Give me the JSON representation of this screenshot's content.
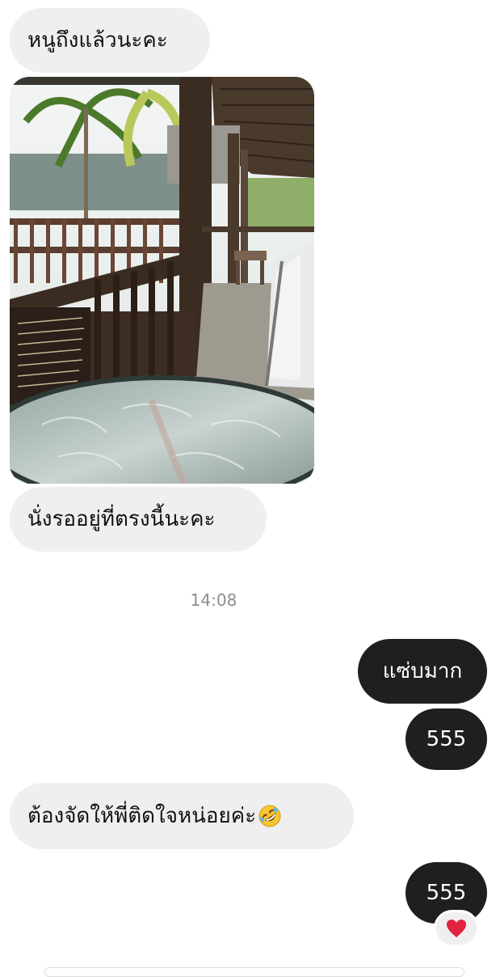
{
  "messages": [
    {
      "text": "หนูถึงแล้วนะคะ"
    },
    {
      "image": "veranda-photo"
    },
    {
      "text": "นั่งรออยู่ที่ตรงนี้นะคะ"
    },
    {
      "text": "แซ่บมาก"
    },
    {
      "text": "555"
    },
    {
      "text": "ต้องจัดให้พี่ติดใจหน่อยค่ะ"
    },
    {
      "text": "555"
    }
  ],
  "timestamp": "14:08",
  "emoji": "rolling-on-the-floor-laughing-icon",
  "reaction": "heart-icon",
  "colors": {
    "incoming_bubble": "#efefef",
    "outgoing_bubble": "#1f1f1f",
    "timestamp_text": "#8e8e8e",
    "heart": "#e0243f",
    "emoji_face": "#f7c531"
  }
}
